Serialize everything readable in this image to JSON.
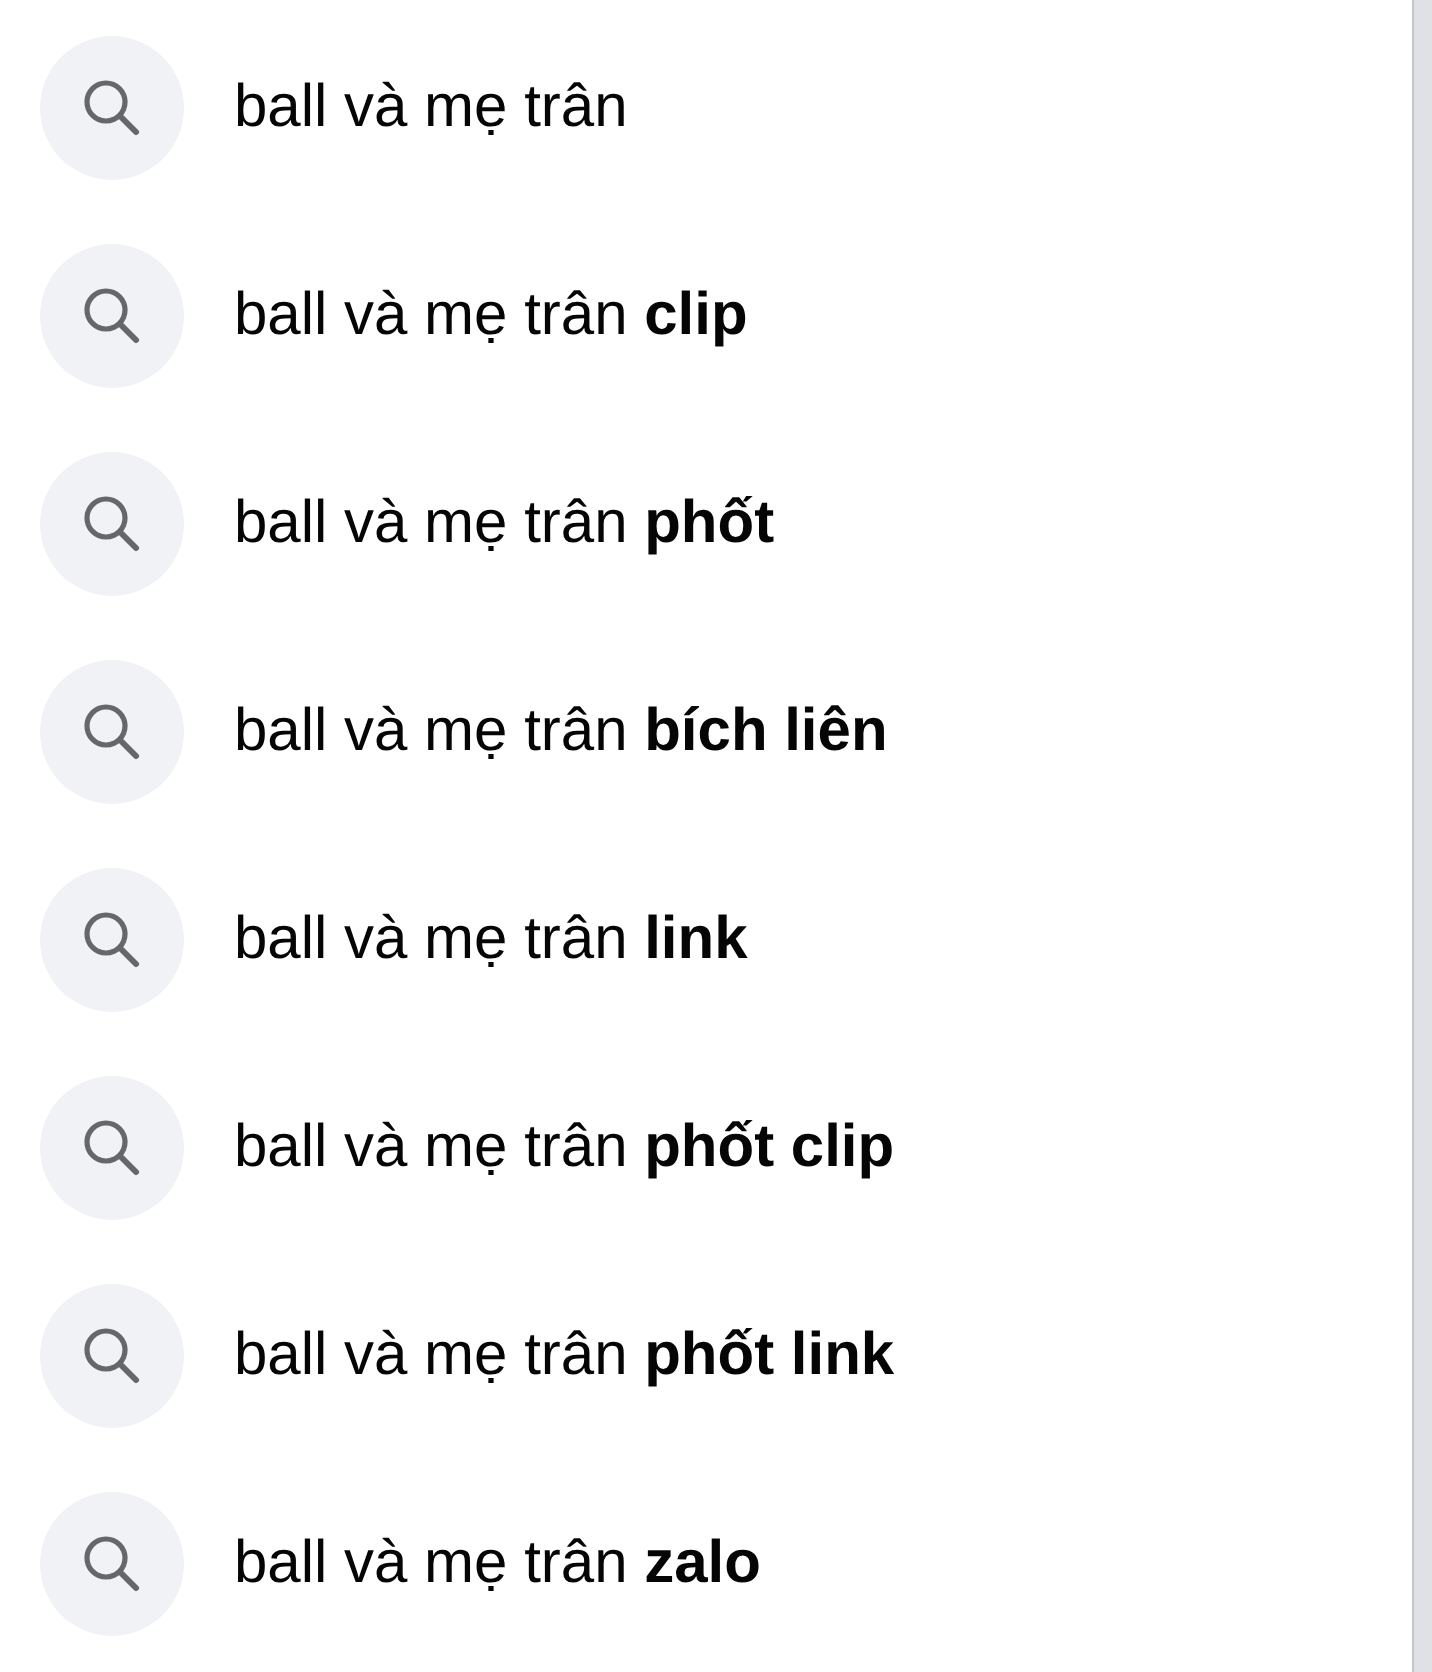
{
  "suggestions": [
    {
      "text": "ball và mẹ trân"
    },
    {
      "text": "ball và mẹ trân **clip**"
    },
    {
      "text": "ball và mẹ trân **phốt**"
    },
    {
      "text": "ball và mẹ trân **bích liên**"
    },
    {
      "text": "ball và mẹ trân **link**"
    },
    {
      "text": "ball và mẹ trân **phốt clip**"
    },
    {
      "text": "ball và mẹ trân **phốt link**"
    },
    {
      "text": "ball và mẹ trân **zalo**"
    }
  ]
}
